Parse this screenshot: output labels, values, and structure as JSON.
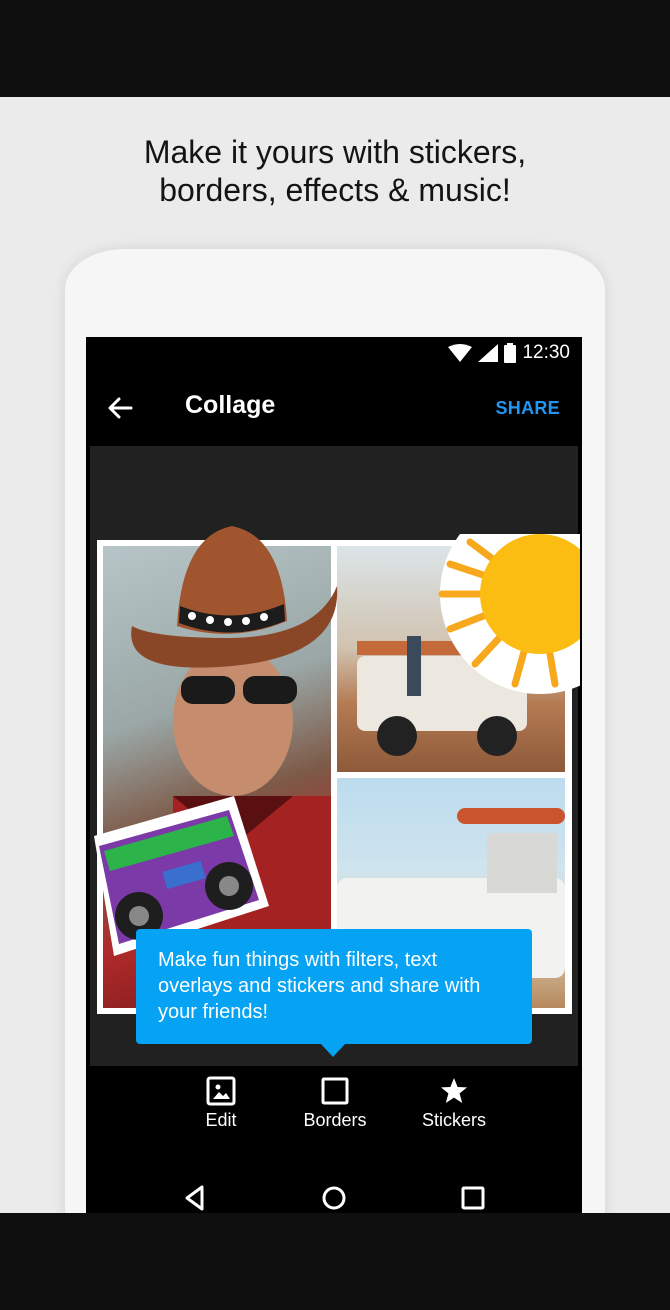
{
  "promo": {
    "headline_line1": "Make it yours with stickers,",
    "headline_line2": "borders, effects & music!"
  },
  "status_bar": {
    "time": "12:30",
    "icons": [
      "wifi-icon",
      "signal-icon",
      "battery-icon"
    ]
  },
  "app_bar": {
    "title": "Collage",
    "share_label": "SHARE",
    "accent_color": "#2196f3"
  },
  "tooltip": {
    "line1": "Make fun things with filters, text",
    "line2": "overlays and stickers and share with",
    "line3": "your friends!",
    "color": "#06a2f4"
  },
  "toolbar": {
    "items": [
      {
        "label": "Edit",
        "icon": "image-icon"
      },
      {
        "label": "Borders",
        "icon": "square-outline-icon"
      },
      {
        "label": "Stickers",
        "icon": "star-icon"
      }
    ]
  },
  "nav_bar": {
    "icons": [
      "back-triangle-icon",
      "home-circle-icon",
      "recents-square-icon"
    ]
  }
}
